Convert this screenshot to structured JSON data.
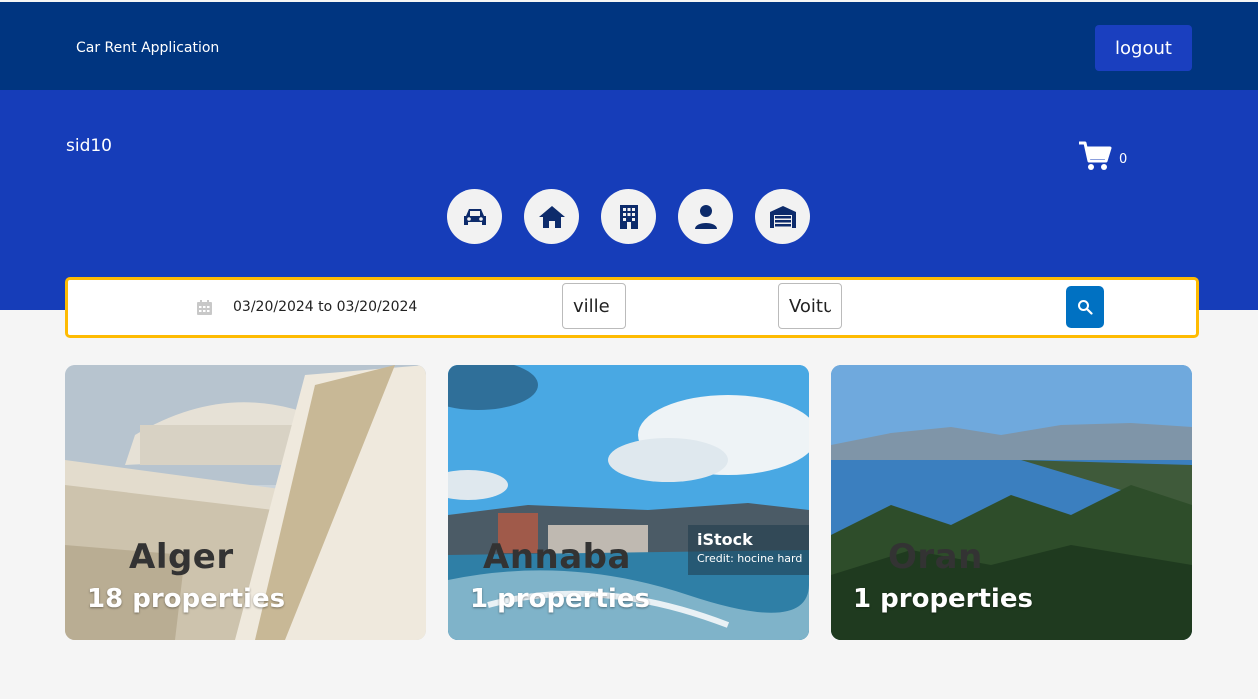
{
  "header": {
    "app_title": "Car Rent Application",
    "logout_label": "logout"
  },
  "hero": {
    "username": "sid10",
    "cart_count": "0",
    "nav_icons": [
      "car-icon",
      "home-icon",
      "building-icon",
      "user-icon",
      "garage-icon"
    ]
  },
  "search": {
    "date_range": "03/20/2024 to 03/20/2024",
    "city_value": "ville",
    "car_value": "Voitu"
  },
  "cards": [
    {
      "city": "Alger",
      "properties": "18 properties"
    },
    {
      "city": "Annaba",
      "properties": "1 properties",
      "watermark_brand": "iStock",
      "watermark_credit": "Credit: hocine hard"
    },
    {
      "city": "Oran",
      "properties": "1 properties"
    }
  ],
  "colors": {
    "topbar": "#003580",
    "hero": "#163db9",
    "accent_border": "#febb02",
    "search_button": "#0071c2"
  }
}
